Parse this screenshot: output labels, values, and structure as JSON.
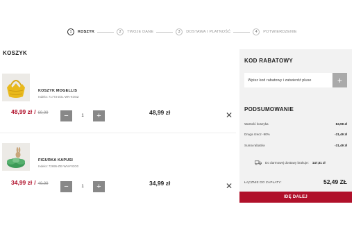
{
  "stepper": {
    "steps": [
      {
        "num": "1",
        "label": "KOSZYK"
      },
      {
        "num": "2",
        "label": "TWOJE DANE"
      },
      {
        "num": "3",
        "label": "DOSTAWA I PŁATNOŚĆ"
      },
      {
        "num": "4",
        "label": "POTWIERDZENIE"
      }
    ]
  },
  "cart": {
    "title": "KOSZYK",
    "items": [
      {
        "name": "KOSZYK MOGELLIS",
        "index": "Indeks: 71773-ZOL-WN-KOSZ",
        "price_new": "48,99 zł",
        "separator": "/",
        "price_old": "69,99",
        "qty_minus": "−",
        "qty": "1",
        "qty_plus": "+",
        "line_total": "48,99 zł",
        "remove": "✕"
      },
      {
        "name": "FIGURKA KAPUSI",
        "index": "Indeks: 72695-ZIE-WN-FIGO0",
        "price_new": "34,99 zł",
        "separator": "/",
        "price_old": "49,99",
        "qty_minus": "−",
        "qty": "1",
        "qty_plus": "+",
        "line_total": "34,99 zł",
        "remove": "✕"
      }
    ]
  },
  "coupon": {
    "title": "KOD RABATOWY",
    "placeholder": "Wpisz kod rabatowy i zatwierdź pluse",
    "button": "+"
  },
  "summary": {
    "title": "PODSUMOWANIE",
    "rows": [
      {
        "label": "Wartość koszyka",
        "value": "83,98 zł"
      },
      {
        "label": "Druga rzecz -90%",
        "value": "-31,49 zł"
      },
      {
        "label": "Suma rabatów",
        "value": "-31,49 zł"
      }
    ],
    "delivery_text": "Do darmowej dostawy brakuje:",
    "delivery_value": "147,51 zł",
    "total_label": "ŁĄCZNIE DO ZAPŁATY:",
    "total_value": "52,49 ZŁ",
    "cta": "IDĘ DALEJ"
  },
  "colors": {
    "accent": "#b0102a",
    "sidebar_bg": "#f2f2f2",
    "qty_button": "#888888"
  },
  "icons": {
    "truck": "truck-icon",
    "remove": "close-icon"
  }
}
